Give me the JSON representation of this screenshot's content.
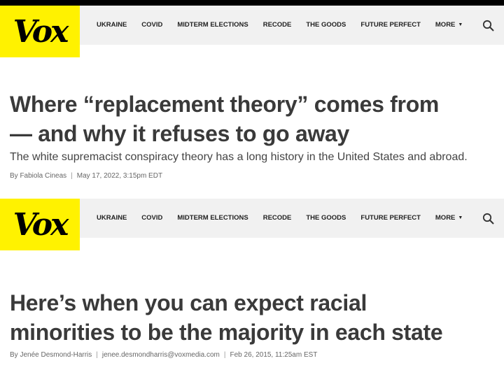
{
  "nav": {
    "logo": "Vox",
    "items": [
      "UKRAINE",
      "COVID",
      "MIDTERM ELECTIONS",
      "RECODE",
      "THE GOODS",
      "FUTURE PERFECT",
      "MORE"
    ],
    "search_icon": "search-icon",
    "logo_color": "#fff200"
  },
  "articles": [
    {
      "headline_line1": "Where “replacement theory” comes from",
      "headline_line2": "— and why it refuses to go away",
      "dek": "The white supremacist conspiracy theory has a long history in the United States and abroad.",
      "author": "By Fabiola Cineas",
      "date": "May 17, 2022, 3:15pm EDT"
    },
    {
      "headline_line1": "Here’s when you can expect racial",
      "headline_line2": "minorities to be the majority in each state",
      "author": "By Jenée Desmond-Harris",
      "email": "jenee.desmondharris@voxmedia.com",
      "date": "Feb 26, 2015, 11:25am EST"
    }
  ]
}
